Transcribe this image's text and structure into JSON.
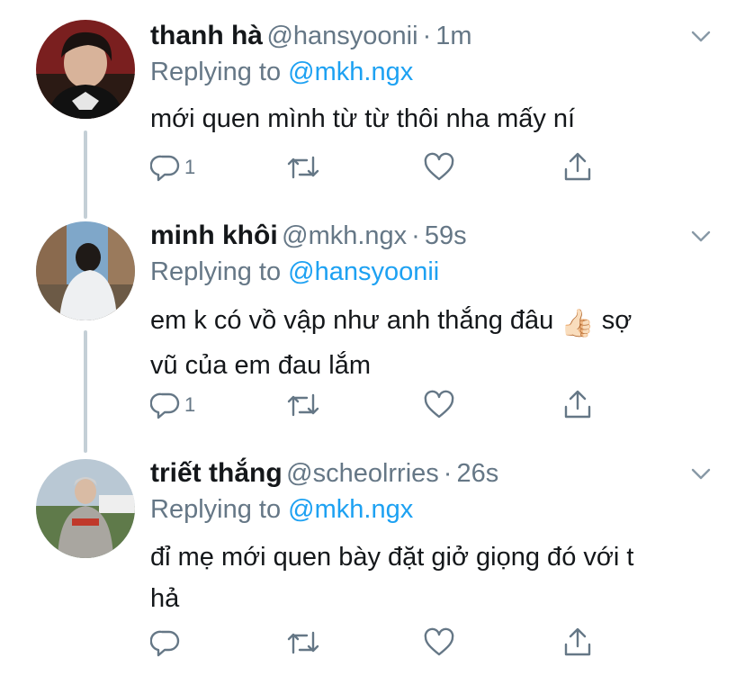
{
  "tweets": [
    {
      "name": "thanh hà",
      "handle": "@hansyoonii",
      "time": "1m",
      "replying_prefix": "Replying to",
      "replying_to": "@mkh.ngx",
      "text": "mới quen mình từ từ thôi nha mấy ní",
      "reply_count": "1",
      "avatar": "avatar-thanh-ha"
    },
    {
      "name": "minh khôi",
      "handle": "@mkh.ngx",
      "time": "59s",
      "replying_prefix": "Replying to",
      "replying_to": "@hansyoonii",
      "text_line1": "em k có vồ vập như anh thắng đâu",
      "emoji": "👍🏻",
      "text_line1_end": "sợ",
      "text_line2": "vũ của em đau lắm",
      "reply_count": "1",
      "avatar": "avatar-minh-khoi"
    },
    {
      "name": "triết thắng",
      "handle": "@scheolrries",
      "time": "26s",
      "replying_prefix": "Replying to",
      "replying_to": "@mkh.ngx",
      "text_line1": "đỉ mẹ mới quen bày đặt giở giọng đó với t",
      "text_line2": "hả",
      "reply_count": "",
      "avatar": "avatar-triet-thang"
    }
  ],
  "icons": [
    "reply-icon",
    "retweet-icon",
    "like-icon",
    "share-icon",
    "chevron-down-icon"
  ],
  "colors": {
    "name": "#14171a",
    "secondary": "#657786",
    "mention": "#1da1f2",
    "thread_line": "#c4cfd6"
  }
}
